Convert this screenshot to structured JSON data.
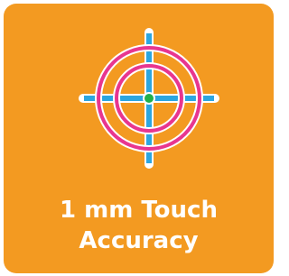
{
  "caption": {
    "line1": "1 mm Touch",
    "line2": "Accuracy"
  },
  "icon": "crosshair-target-icon",
  "colors": {
    "background": "#F39A21",
    "ring": "#E8368F",
    "crosshair": "#2CA6E0",
    "center_dot": "#22B14C",
    "outline": "#FFFFFF",
    "text": "#FFFFFF"
  }
}
